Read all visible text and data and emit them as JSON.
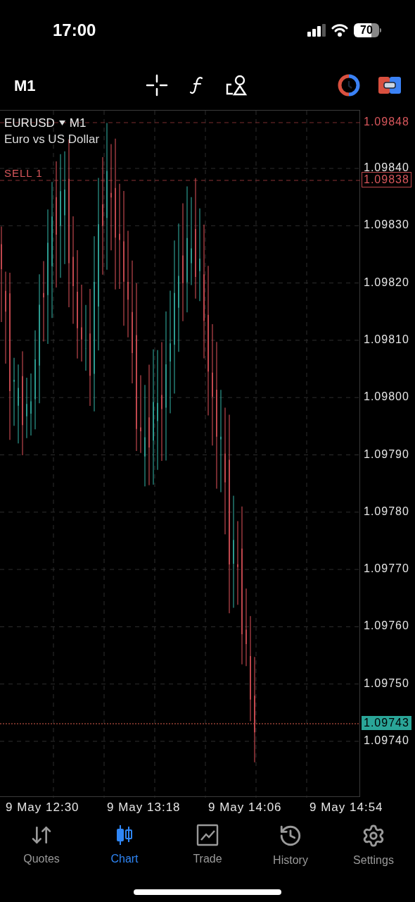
{
  "status_bar": {
    "time": "17:00",
    "battery": "70"
  },
  "toolbar": {
    "timeframe": "M1"
  },
  "chart": {
    "symbol": "EURUSD",
    "symbol_timeframe": "M1",
    "description": "Euro vs US Dollar",
    "order_label": "SELL 1",
    "price_labels": [
      {
        "text": "1.09848",
        "kind": "high"
      },
      {
        "text": "1.09840",
        "kind": "grid"
      },
      {
        "text": "1.09838",
        "kind": "order"
      },
      {
        "text": "1.09830",
        "kind": "grid"
      },
      {
        "text": "1.09820",
        "kind": "grid"
      },
      {
        "text": "1.09810",
        "kind": "grid"
      },
      {
        "text": "1.09800",
        "kind": "grid"
      },
      {
        "text": "1.09790",
        "kind": "grid"
      },
      {
        "text": "1.09780",
        "kind": "grid"
      },
      {
        "text": "1.09770",
        "kind": "grid"
      },
      {
        "text": "1.09760",
        "kind": "grid"
      },
      {
        "text": "1.09750",
        "kind": "grid"
      },
      {
        "text": "1.09743",
        "kind": "bid"
      },
      {
        "text": "1.09740",
        "kind": "grid"
      }
    ],
    "time_labels": [
      "9 May 12:30",
      "9 May 13:18",
      "9 May 14:06",
      "9 May 14:54"
    ]
  },
  "tabs": [
    {
      "label": "Quotes",
      "selected": false
    },
    {
      "label": "Chart",
      "selected": true
    },
    {
      "label": "Trade",
      "selected": false
    },
    {
      "label": "History",
      "selected": false
    },
    {
      "label": "Settings",
      "selected": false
    }
  ]
}
